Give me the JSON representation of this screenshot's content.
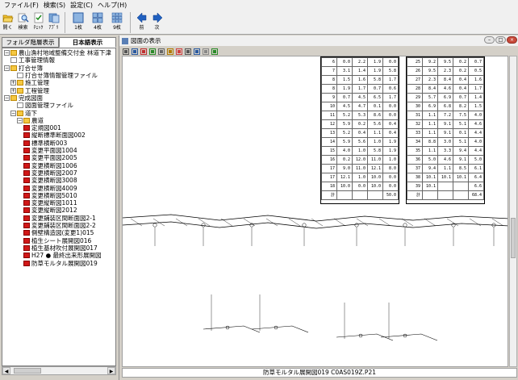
{
  "menubar": {
    "items": [
      "ファイル(F)",
      "検索(S)",
      "設定(C)",
      "ヘルプ(H)"
    ]
  },
  "toolbar": {
    "buttons": [
      {
        "label": "開く",
        "icon": "open-folder-icon"
      },
      {
        "label": "検索",
        "icon": "search-icon"
      },
      {
        "label": "ﾁｪｯｸ",
        "icon": "check-icon"
      },
      {
        "label": "ｱﾌﾟﾘ",
        "icon": "app-icon"
      },
      {
        "label": "1枚",
        "icon": "single-page-icon"
      },
      {
        "label": "4枚",
        "icon": "four-page-icon"
      },
      {
        "label": "9枚",
        "icon": "nine-page-icon"
      },
      {
        "label": "前",
        "icon": "previous-arrow-icon"
      },
      {
        "label": "次",
        "icon": "next-arrow-icon"
      }
    ]
  },
  "tabs": {
    "folder": "フォルダ階層表示",
    "japanese": "日本語表示"
  },
  "tree": {
    "rows": [
      {
        "label": "農山漁村地域整備交付金 林道下津",
        "indent": 0,
        "icon": "folder",
        "exp": "-"
      },
      {
        "label": "工事管理情報",
        "indent": 1,
        "icon": "page",
        "exp": ""
      },
      {
        "label": "打合せ簿",
        "indent": 0,
        "icon": "folder",
        "exp": "-"
      },
      {
        "label": "打合せ簿情報管理ファイル",
        "indent": 2,
        "icon": "page",
        "exp": ""
      },
      {
        "label": "施工管理",
        "indent": 1,
        "icon": "folder",
        "exp": "+"
      },
      {
        "label": "工程管理",
        "indent": 1,
        "icon": "folder",
        "exp": "+"
      },
      {
        "label": "完成図面",
        "indent": 0,
        "icon": "folder",
        "exp": "-"
      },
      {
        "label": "図面管理ファイル",
        "indent": 2,
        "icon": "page",
        "exp": ""
      },
      {
        "label": "道下",
        "indent": 1,
        "icon": "folder",
        "exp": "-"
      },
      {
        "label": "農道",
        "indent": 2,
        "icon": "folder",
        "exp": "-"
      },
      {
        "label": "定規図001",
        "indent": 3,
        "icon": "pdf",
        "exp": ""
      },
      {
        "label": "縦断標準断面図002",
        "indent": 3,
        "icon": "pdf",
        "exp": ""
      },
      {
        "label": "標準横断003",
        "indent": 3,
        "icon": "pdf",
        "exp": ""
      },
      {
        "label": "変更平面図1004",
        "indent": 3,
        "icon": "pdf",
        "exp": ""
      },
      {
        "label": "変更平面図2005",
        "indent": 3,
        "icon": "pdf",
        "exp": ""
      },
      {
        "label": "変更横断図1006",
        "indent": 3,
        "icon": "pdf",
        "exp": ""
      },
      {
        "label": "変更横断図2007",
        "indent": 3,
        "icon": "pdf",
        "exp": ""
      },
      {
        "label": "変更横断図3008",
        "indent": 3,
        "icon": "pdf",
        "exp": ""
      },
      {
        "label": "変更横断図4009",
        "indent": 3,
        "icon": "pdf",
        "exp": ""
      },
      {
        "label": "変更横断図5010",
        "indent": 3,
        "icon": "pdf",
        "exp": ""
      },
      {
        "label": "変更縦断図1011",
        "indent": 3,
        "icon": "pdf",
        "exp": ""
      },
      {
        "label": "変更縦断図2012",
        "indent": 3,
        "icon": "pdf",
        "exp": ""
      },
      {
        "label": "変更鋪装区間断面図2-1",
        "indent": 3,
        "icon": "pdf",
        "exp": ""
      },
      {
        "label": "変更鋪装区間断面図2-2",
        "indent": 3,
        "icon": "pdf",
        "exp": ""
      },
      {
        "label": "側壁構造図(変更1)015",
        "indent": 3,
        "icon": "pdf",
        "exp": ""
      },
      {
        "label": "植生シート展開図016",
        "indent": 3,
        "icon": "pdf",
        "exp": ""
      },
      {
        "label": "植生基材吹付展開図017",
        "indent": 3,
        "icon": "pdf",
        "exp": ""
      },
      {
        "label": "H27 ● 最終出来形展開図",
        "indent": 3,
        "icon": "pdf",
        "exp": ""
      },
      {
        "label": "防草モルタル展開図019",
        "indent": 3,
        "icon": "pdf",
        "exp": ""
      }
    ]
  },
  "viewer": {
    "title": "図面の表示",
    "footer": "防草モルタル展開図019  C0AS019Z.P21",
    "window_controls": [
      "–",
      "□",
      "×"
    ],
    "tool_icons": [
      "print-icon",
      "zoom-icon",
      "rotate-icon",
      "fit-icon",
      "grid-icon",
      "layer-icon",
      "color-icon",
      "text-icon",
      "measure-icon",
      "export-icon",
      "info-icon"
    ]
  },
  "drawing": {
    "table_left": {
      "rows": [
        [
          "6",
          "0.0",
          "2.2",
          "1.9",
          "0.0"
        ],
        [
          "7",
          "3.1",
          "1.4",
          "1.9",
          "5.8"
        ],
        [
          "8",
          "1.5",
          "1.6",
          "5.8",
          "1.7"
        ],
        [
          "8",
          "1.9",
          "1.7",
          "0.7",
          "0.6"
        ],
        [
          "9",
          "0.7",
          "4.5",
          "6.5",
          "1.7"
        ],
        [
          "10",
          "4.5",
          "4.7",
          "0.1",
          "0.0"
        ],
        [
          "11",
          "5.2",
          "5.3",
          "8.6",
          "0.0"
        ],
        [
          "12",
          "5.9",
          "0.2",
          "5.6",
          "0.4"
        ],
        [
          "13",
          "5.2",
          "0.4",
          "1.1",
          "0.4"
        ],
        [
          "14",
          "5.9",
          "5.6",
          "1.0",
          "1.9"
        ],
        [
          "15",
          "4.0",
          "1.0",
          "5.8",
          "1.9"
        ],
        [
          "16",
          "0.2",
          "12.0",
          "11.0",
          "1.0"
        ],
        [
          "17",
          "9.0",
          "11.0",
          "12.1",
          "8.0"
        ],
        [
          "17",
          "12.1",
          "1.0",
          "10.0",
          "0.0"
        ],
        [
          "18",
          "10.0",
          "0.0",
          "10.0",
          "0.0"
        ],
        [
          "計",
          "",
          "",
          "",
          "50.0"
        ]
      ]
    },
    "table_right": {
      "rows": [
        [
          "25",
          "9.2",
          "9.5",
          "0.2",
          "0.7"
        ],
        [
          "26",
          "9.5",
          "2.3",
          "0.2",
          "0.5"
        ],
        [
          "27",
          "2.3",
          "8.4",
          "0.4",
          "1.6"
        ],
        [
          "28",
          "8.4",
          "4.6",
          "0.4",
          "1.7"
        ],
        [
          "29",
          "5.7",
          "6.9",
          "0.7",
          "1.4"
        ],
        [
          "30",
          "6.9",
          "6.8",
          "8.2",
          "1.5"
        ],
        [
          "31",
          "1.1",
          "7.2",
          "7.5",
          "4.0"
        ],
        [
          "32",
          "1.1",
          "9.1",
          "5.1",
          "4.6"
        ],
        [
          "33",
          "1.1",
          "9.1",
          "0.1",
          "4.4"
        ],
        [
          "34",
          "8.8",
          "3.0",
          "5.1",
          "4.0"
        ],
        [
          "35",
          "1.1",
          "3.3",
          "9.4",
          "4.4"
        ],
        [
          "36",
          "5.0",
          "4.6",
          "9.1",
          "5.0"
        ],
        [
          "37",
          "9.4",
          "1.1",
          "8.5",
          "6.1"
        ],
        [
          "38",
          "10.1",
          "10.1",
          "10.1",
          "6.4"
        ],
        [
          "39",
          "10.1",
          "",
          "",
          "6.6"
        ],
        [
          "計",
          "",
          "",
          "",
          "68.4"
        ]
      ]
    }
  }
}
